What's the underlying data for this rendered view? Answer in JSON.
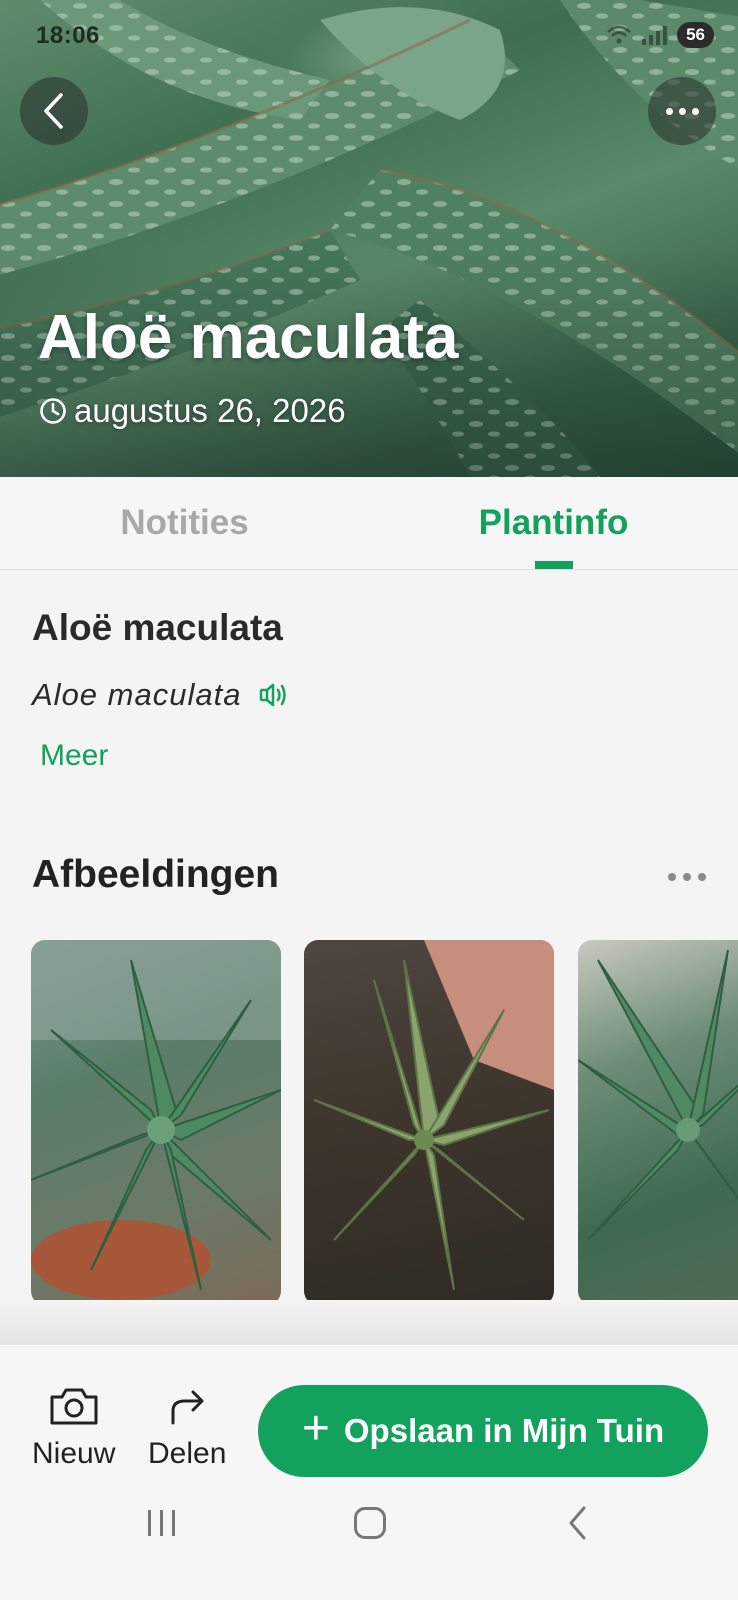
{
  "status_bar": {
    "time": "18:06",
    "battery": "56"
  },
  "hero": {
    "title": "Aloë maculata",
    "date": "augustus 26, 2026",
    "back_icon": "chevron-left-icon",
    "more_icon": "more-horizontal-icon"
  },
  "tabs": [
    {
      "label": "Notities",
      "active": false
    },
    {
      "label": "Plantinfo",
      "active": true
    }
  ],
  "plant": {
    "name": "Aloë maculata",
    "scientific_name": "Aloe maculata",
    "speaker_icon": "speaker-icon",
    "more_link": "Meer"
  },
  "images": {
    "heading": "Afbeeldingen",
    "more_icon": "more-horizontal-icon",
    "thumbnails": [
      "aloe-photo-1",
      "aloe-photo-2",
      "aloe-photo-3"
    ]
  },
  "actions": {
    "new_label": "Nieuw",
    "new_icon": "camera-icon",
    "share_label": "Delen",
    "share_icon": "share-arrow-icon",
    "save_label": "Opslaan in Mijn Tuin",
    "save_icon": "plus-icon"
  },
  "colors": {
    "accent": "#13a15e",
    "tab_inactive": "#a8a8a8",
    "background": "#f4f4f4"
  }
}
